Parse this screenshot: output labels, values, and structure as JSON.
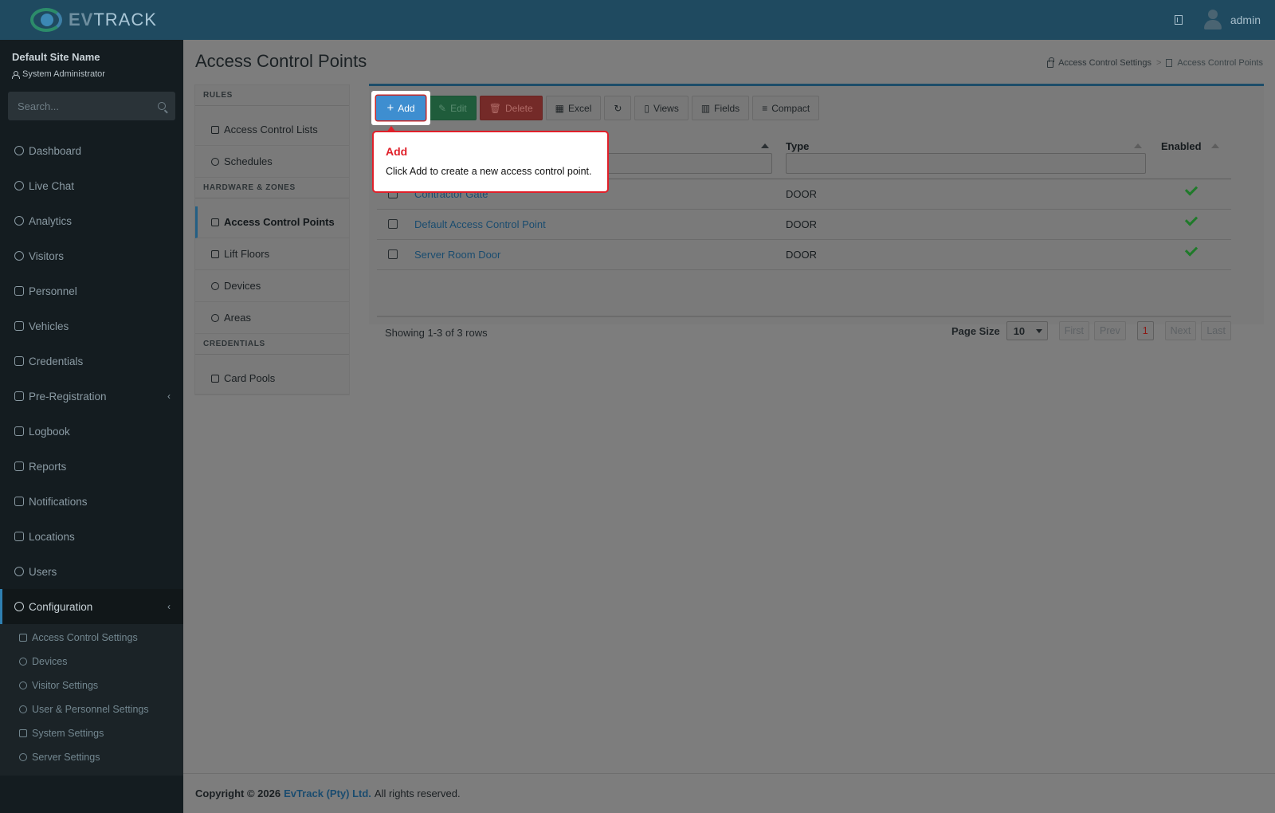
{
  "app": {
    "logo_text_bold": "EV",
    "logo_text": "TRACK",
    "user": "admin"
  },
  "sidebar": {
    "site_name": "Default Site Name",
    "role": "System Administrator",
    "search_placeholder": "Search...",
    "items": [
      {
        "label": "Dashboard",
        "icon": "gauge-icon"
      },
      {
        "label": "Live Chat",
        "icon": "headset-icon"
      },
      {
        "label": "Analytics",
        "icon": "target-icon"
      },
      {
        "label": "Visitors",
        "icon": "eye-icon"
      },
      {
        "label": "Personnel",
        "icon": "user-tie-icon"
      },
      {
        "label": "Vehicles",
        "icon": "car-icon"
      },
      {
        "label": "Credentials",
        "icon": "id-card-icon"
      },
      {
        "label": "Pre-Registration",
        "icon": "arrows-icon",
        "expand": "‹"
      },
      {
        "label": "Logbook",
        "icon": "book-icon"
      },
      {
        "label": "Reports",
        "icon": "chart-icon"
      },
      {
        "label": "Notifications",
        "icon": "message-icon"
      },
      {
        "label": "Locations",
        "icon": "map-icon"
      },
      {
        "label": "Users",
        "icon": "users-cog-icon"
      },
      {
        "label": "Configuration",
        "icon": "gear-icon",
        "expand": "‹"
      }
    ],
    "config_sub": [
      {
        "label": "Access Control Settings",
        "icon": "lock-icon"
      },
      {
        "label": "Devices",
        "icon": "chip-icon"
      },
      {
        "label": "Visitor Settings",
        "icon": "eye-icon"
      },
      {
        "label": "User & Personnel Settings",
        "icon": "users-cog-icon"
      },
      {
        "label": "System Settings",
        "icon": "sliders-icon"
      },
      {
        "label": "Server Settings",
        "icon": "wrench-icon"
      }
    ]
  },
  "page": {
    "title": "Access Control Points",
    "breadcrumb": [
      "Access Control Settings",
      "Access Control Points"
    ],
    "breadcrumb_sep": ">"
  },
  "submenu": {
    "sections": [
      {
        "title": "RULES",
        "links": [
          "Access Control Lists",
          "Schedules"
        ]
      },
      {
        "title": "HARDWARE & ZONES",
        "links": [
          "Access Control Points",
          "Lift Floors",
          "Devices",
          "Areas"
        ]
      },
      {
        "title": "CREDENTIALS",
        "links": [
          "Card Pools"
        ]
      }
    ],
    "selected": "Access Control Points"
  },
  "toolbar": {
    "add": "Add",
    "edit": "Edit",
    "delete": "Delete",
    "excel": "Excel",
    "views": "Views",
    "fields": "Fields",
    "compact": "Compact"
  },
  "table": {
    "columns": {
      "type": "Type",
      "enabled": "Enabled"
    },
    "rows": [
      {
        "name": "Contractor Gate",
        "type": "DOOR",
        "enabled": true
      },
      {
        "name": "Default Access Control Point",
        "type": "DOOR",
        "enabled": true
      },
      {
        "name": "Server Room Door",
        "type": "DOOR",
        "enabled": true
      }
    ],
    "showing": "Showing 1-3 of 3 rows",
    "page_size_label": "Page Size",
    "page_size": "10",
    "pager": {
      "first": "First",
      "prev": "Prev",
      "current": "1",
      "next": "Next",
      "last": "Last"
    }
  },
  "tooltip": {
    "title": "Add",
    "body": "Click Add to create a new access control point."
  },
  "footer": {
    "prefix": "Copyright © 2026",
    "brand": "EvTrack (Pty) Ltd.",
    "suffix": "All rights reserved."
  },
  "colors": {
    "header": "#1f4a60",
    "sidebar": "#141c20",
    "accent": "#3e8ed0",
    "tooltip_accent": "#e0202a"
  }
}
